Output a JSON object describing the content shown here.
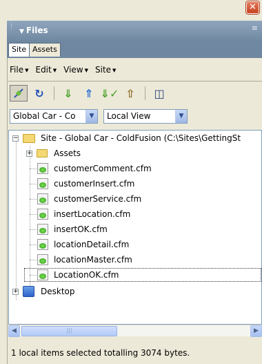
{
  "panel": {
    "title": "Files",
    "tabs": [
      {
        "label": "Site",
        "active": true
      },
      {
        "label": "Assets",
        "active": false
      }
    ]
  },
  "menu": {
    "items": [
      "File",
      "Edit",
      "View",
      "Site"
    ]
  },
  "toolbar": {
    "buttons": [
      "connect-icon",
      "refresh-icon",
      "get-files-icon",
      "put-files-icon",
      "check-out-icon",
      "check-in-icon",
      "expand-collapse-icon"
    ]
  },
  "selectors": {
    "site": "Global Car - Co",
    "view": "Local View"
  },
  "tree": {
    "root": "Site - Global Car - ColdFusion (C:\\Sites\\GettingSt",
    "folder": "Assets",
    "files": [
      "customerComment.cfm",
      "customerInsert.cfm",
      "customerService.cfm",
      "insertLocation.cfm",
      "insertOK.cfm",
      "locationDetail.cfm",
      "locationMaster.cfm",
      "LocationOK.cfm"
    ],
    "desktop": "Desktop"
  },
  "status": {
    "text": "1 local items selected totalling 3074 bytes."
  },
  "colors": {
    "header": "#6f87a0",
    "panel_bg": "#ece9d8",
    "close": "#c8411e"
  }
}
